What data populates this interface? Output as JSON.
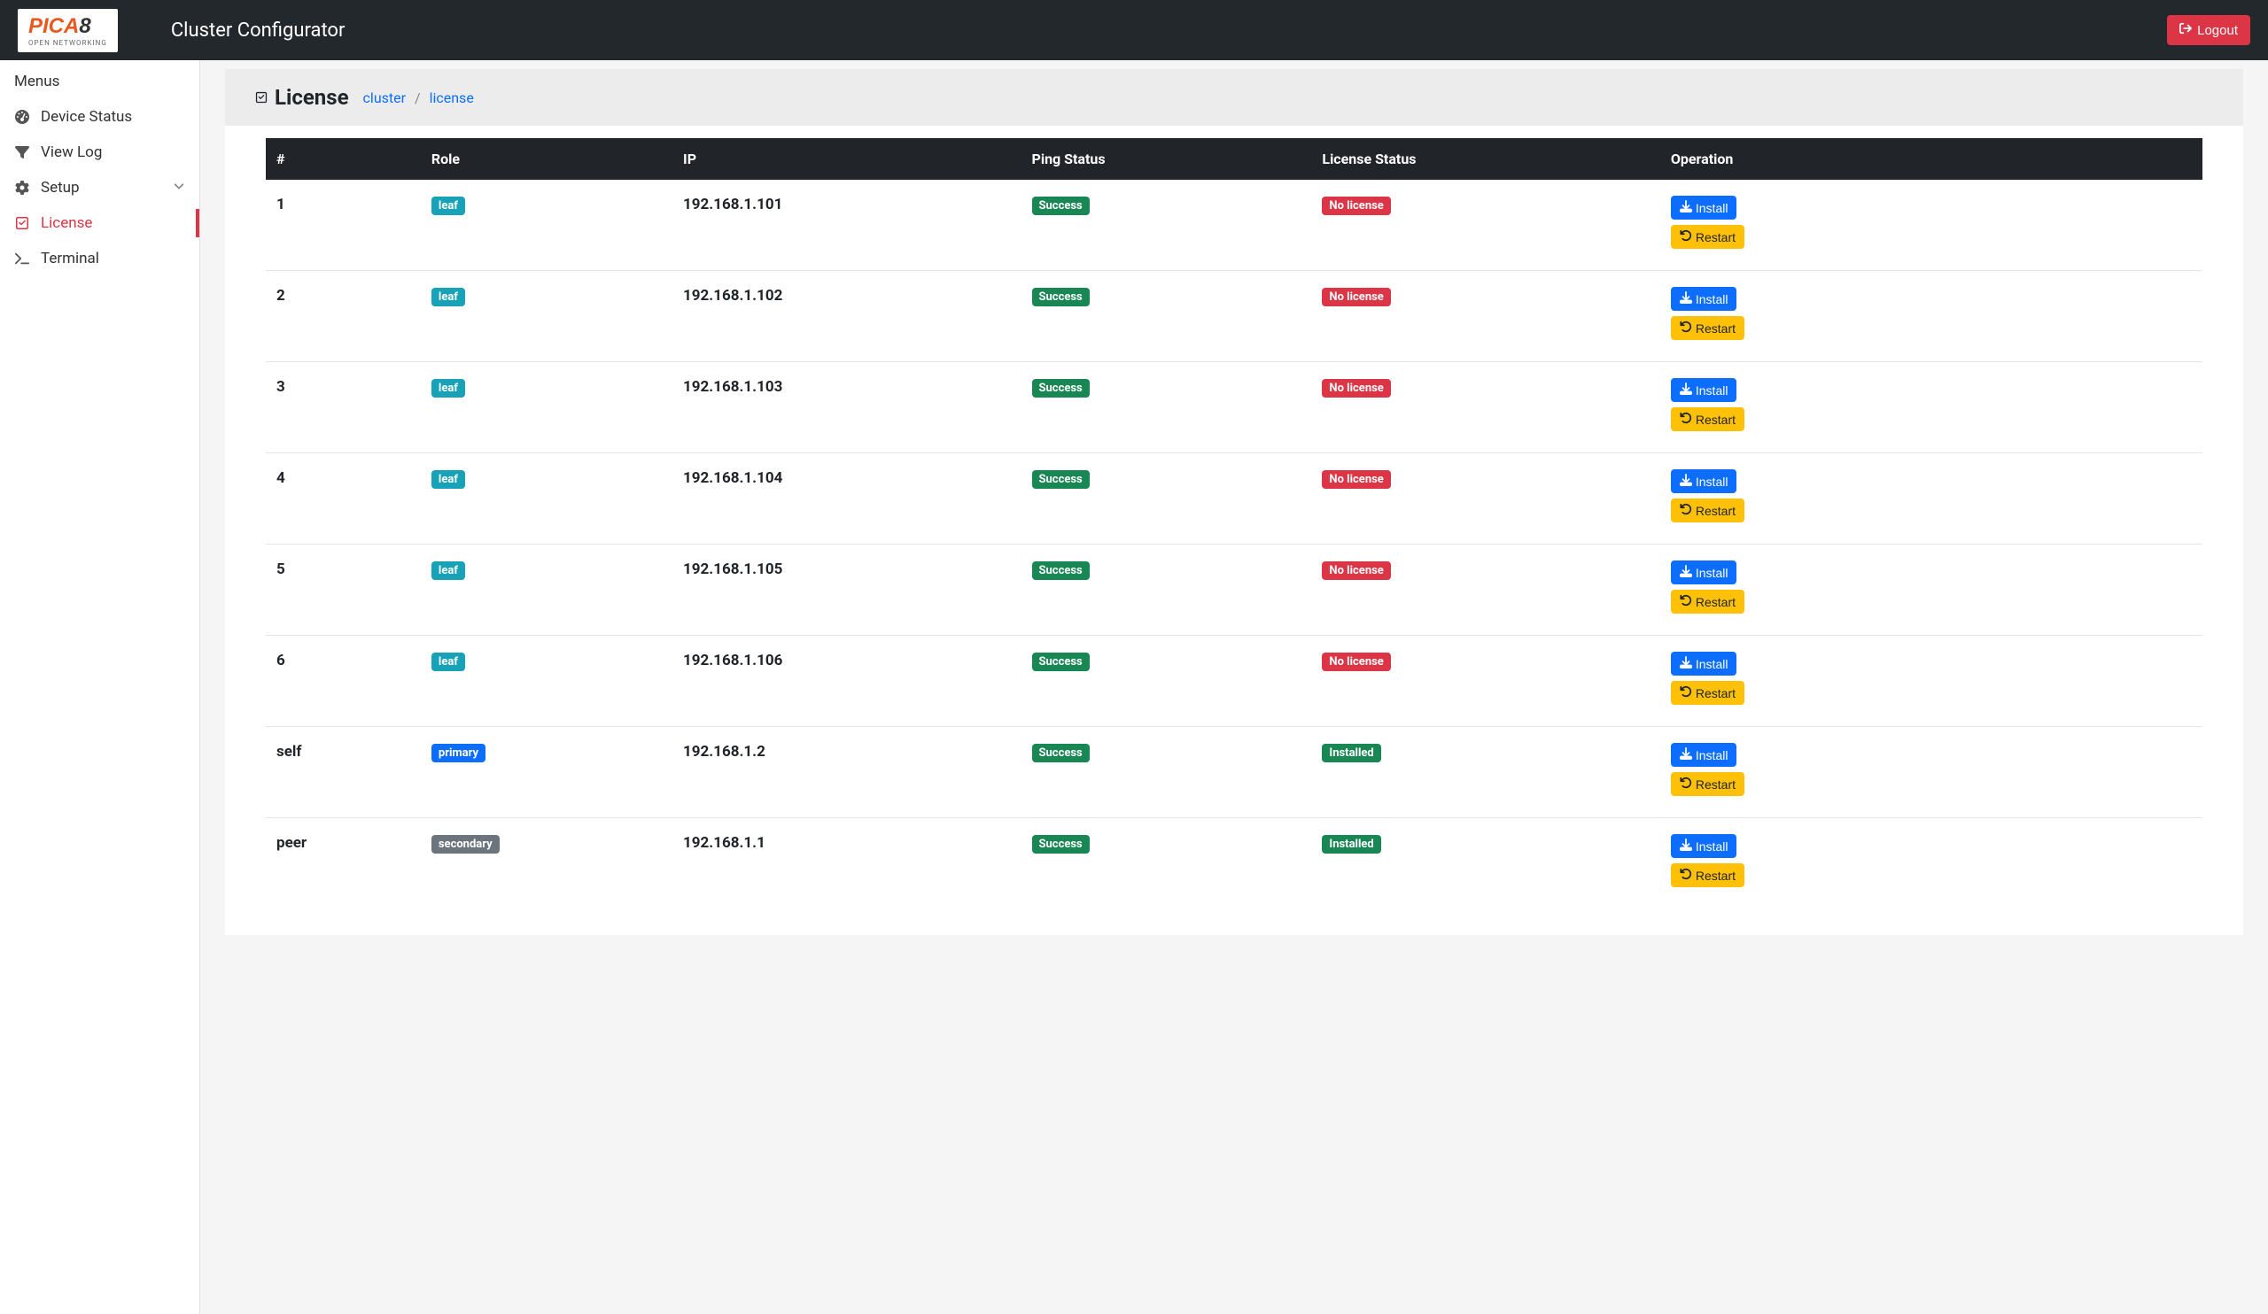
{
  "navbar": {
    "app_title": "Cluster Configurator",
    "logout_label": "Logout",
    "logo_main": "PICA",
    "logo_accent": "8",
    "logo_sub": "OPEN NETWORKING"
  },
  "sidebar": {
    "header": "Menus",
    "items": [
      {
        "label": "Device Status",
        "active": false,
        "icon": "gauge"
      },
      {
        "label": "View Log",
        "active": false,
        "icon": "filter"
      },
      {
        "label": "Setup",
        "active": false,
        "icon": "gear",
        "expandable": true
      },
      {
        "label": "License",
        "active": true,
        "icon": "check"
      },
      {
        "label": "Terminal",
        "active": false,
        "icon": "prompt"
      }
    ]
  },
  "page": {
    "title": "License",
    "breadcrumb": [
      {
        "label": "cluster",
        "link": true
      },
      {
        "label": "license",
        "link": true
      }
    ]
  },
  "table": {
    "headers": [
      "#",
      "Role",
      "IP",
      "Ping Status",
      "License Status",
      "Operation"
    ],
    "install_label": "Install",
    "restart_label": "Restart",
    "rows": [
      {
        "num": "1",
        "role": "leaf",
        "role_variant": "info",
        "ip": "192.168.1.101",
        "ping": "Success",
        "license": "No license",
        "license_variant": "danger"
      },
      {
        "num": "2",
        "role": "leaf",
        "role_variant": "info",
        "ip": "192.168.1.102",
        "ping": "Success",
        "license": "No license",
        "license_variant": "danger"
      },
      {
        "num": "3",
        "role": "leaf",
        "role_variant": "info",
        "ip": "192.168.1.103",
        "ping": "Success",
        "license": "No license",
        "license_variant": "danger"
      },
      {
        "num": "4",
        "role": "leaf",
        "role_variant": "info",
        "ip": "192.168.1.104",
        "ping": "Success",
        "license": "No license",
        "license_variant": "danger"
      },
      {
        "num": "5",
        "role": "leaf",
        "role_variant": "info",
        "ip": "192.168.1.105",
        "ping": "Success",
        "license": "No license",
        "license_variant": "danger"
      },
      {
        "num": "6",
        "role": "leaf",
        "role_variant": "info",
        "ip": "192.168.1.106",
        "ping": "Success",
        "license": "No license",
        "license_variant": "danger"
      },
      {
        "num": "self",
        "role": "primary",
        "role_variant": "primary",
        "ip": "192.168.1.2",
        "ping": "Success",
        "license": "Installed",
        "license_variant": "success"
      },
      {
        "num": "peer",
        "role": "secondary",
        "role_variant": "secondary",
        "ip": "192.168.1.1",
        "ping": "Success",
        "license": "Installed",
        "license_variant": "success"
      }
    ]
  }
}
